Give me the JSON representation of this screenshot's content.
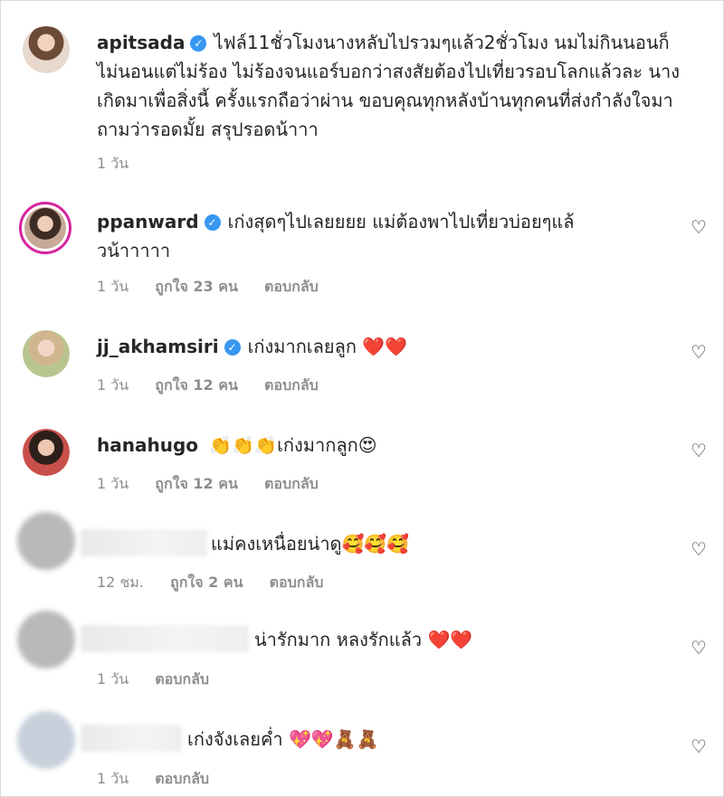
{
  "comments": [
    {
      "username": "apitsada",
      "verified": true,
      "text": "ไฟล์11ชั่วโมงนางหลับไปรวมๆแล้ว2ชั่วโมง นมไม่กินนอนก็ไม่นอนแต่ไม่ร้อง ไม่ร้องจนแอร์บอกว่าสงสัยต้องไปเที่ยวรอบโลกแล้วละ นางเกิดมาเพื่อสิ่งนี้ ครั้งแรกถือว่าผ่าน ขอบคุณทุกหลังบ้านทุกคนที่ส่งกำลังใจมาถามว่ารอดมั้ย สรุปรอดน้าาา",
      "time": "1 วัน"
    },
    {
      "username": "ppanward",
      "verified": true,
      "text": "เก่งสุดๆไปเลยยยย แม่ต้องพาไปเที่ยวบ่อยๆแล้วน้าาาาา",
      "time": "1 วัน",
      "likes": "ถูกใจ 23 คน",
      "reply": "ตอบกลับ"
    },
    {
      "username": "jj_akhamsiri",
      "verified": true,
      "text": "เก่งมากเลยลูก",
      "emoji": "❤️❤️",
      "time": "1 วัน",
      "likes": "ถูกใจ 12 คน",
      "reply": "ตอบกลับ"
    },
    {
      "username": "hanahugo",
      "verified": false,
      "pre_emoji": "👏👏👏",
      "text": "เก่งมากลูก",
      "emoji": "😍",
      "time": "1 วัน",
      "likes": "ถูกใจ 12 คน",
      "reply": "ตอบกลับ"
    },
    {
      "text": "แม่คงเหนื่อยน่าดู",
      "emoji": "🥰🥰🥰",
      "time": "12 ชม.",
      "likes": "ถูกใจ 2 คน",
      "reply": "ตอบกลับ"
    },
    {
      "text": "น่ารักมาก หลงรักแล้ว",
      "emoji": "❤️❤️",
      "time": "1 วัน",
      "reply": "ตอบกลับ"
    },
    {
      "text": "เก่งจังเลยค่ำ",
      "emoji": "💖💖🧸🧸",
      "time": "1 วัน",
      "reply": "ตอบกลับ"
    }
  ],
  "icons": {
    "heart": "heart-outline-icon",
    "verified": "verified-badge-icon"
  },
  "colors": {
    "verified": "#3897f0",
    "meta": "#8e8e8e",
    "ring": "#d6249f"
  }
}
